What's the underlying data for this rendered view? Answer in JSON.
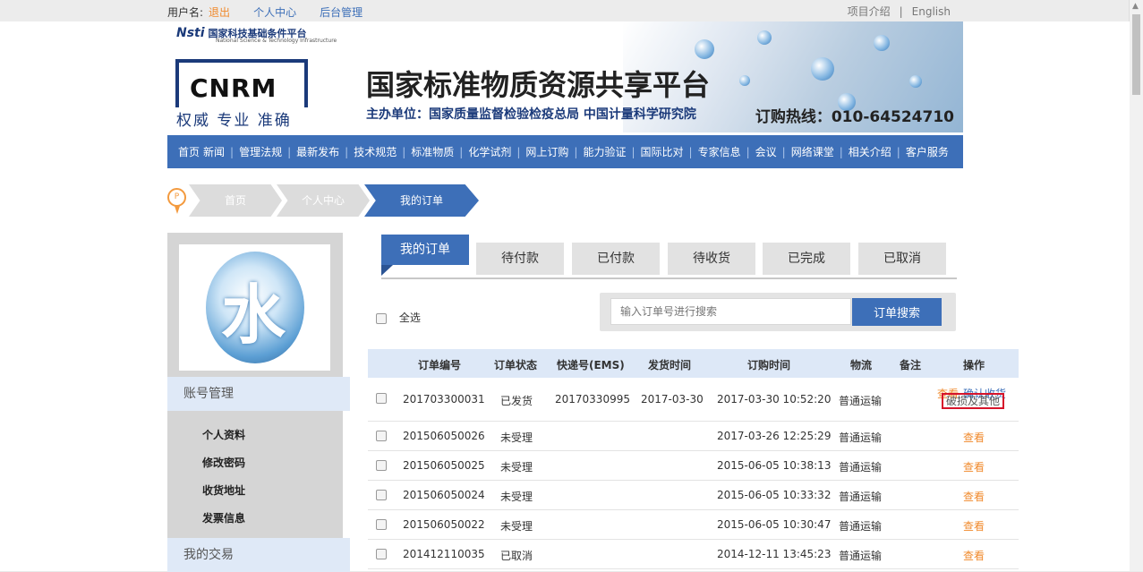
{
  "topbar": {
    "username_label": "用户名:",
    "logout": "退出",
    "personal_center": "个人中心",
    "admin": "后台管理",
    "project_intro": "项目介绍",
    "separator": "|",
    "english": "English"
  },
  "header": {
    "nsti_logo": "Nsti",
    "nsti_name": "国家科技基础条件平台",
    "nsti_sub": "National Science & Technology Infrastructure",
    "cnrm_logo": "CNRM",
    "slogan": "权威 专业 准确",
    "site_title": "国家标准物质资源共享平台",
    "organizer": "主办单位：国家质量监督检验检疫总局 中国计量科学研究院",
    "hotline": "订购热线：010-64524710"
  },
  "nav": {
    "items": [
      "首页",
      "新闻",
      "管理法规",
      "最新发布",
      "技术规范",
      "标准物质",
      "化学试剂",
      "网上订购",
      "能力验证",
      "国际比对",
      "专家信息",
      "会议",
      "网络课堂",
      "相关介绍",
      "客户服务"
    ]
  },
  "breadcrumb": {
    "pin": "P",
    "home": "首页",
    "personal_center": "个人中心",
    "my_orders": "我的订单"
  },
  "sidebar": {
    "avatar_char": "水",
    "account_title": "账号管理",
    "items": [
      "个人资料",
      "修改密码",
      "收货地址",
      "发票信息"
    ],
    "trade_title": "我的交易"
  },
  "tabs": [
    "我的订单",
    "待付款",
    "已付款",
    "待收货",
    "已完成",
    "已取消"
  ],
  "toolbar": {
    "select_all": "全选",
    "search_placeholder": "输入订单号进行搜索",
    "search_button": "订单搜索"
  },
  "table": {
    "headers": [
      "订单编号",
      "订单状态",
      "快递号(EMS)",
      "发货时间",
      "订购时间",
      "物流",
      "备注",
      "操作"
    ],
    "rows": [
      {
        "id": "201703300031",
        "status": "已发货",
        "ems": "20170330995",
        "ship": "2017-03-30",
        "order_time": "2017-03-30 10:52:20",
        "logistics": "普通运输",
        "view": "查看",
        "confirm": "确认收货",
        "damage": "破损及其他"
      },
      {
        "id": "201506050026",
        "status": "未受理",
        "ems": "",
        "ship": "",
        "order_time": "2017-03-26 12:25:29",
        "logistics": "普通运输",
        "view": "查看"
      },
      {
        "id": "201506050025",
        "status": "未受理",
        "ems": "",
        "ship": "",
        "order_time": "2015-06-05 10:38:13",
        "logistics": "普通运输",
        "view": "查看"
      },
      {
        "id": "201506050024",
        "status": "未受理",
        "ems": "",
        "ship": "",
        "order_time": "2015-06-05 10:33:32",
        "logistics": "普通运输",
        "view": "查看"
      },
      {
        "id": "201506050022",
        "status": "未受理",
        "ems": "",
        "ship": "",
        "order_time": "2015-06-05 10:30:47",
        "logistics": "普通运输",
        "view": "查看"
      },
      {
        "id": "201412110035",
        "status": "已取消",
        "ems": "",
        "ship": "",
        "order_time": "2014-12-11 13:45:23",
        "logistics": "普通运输",
        "view": "查看"
      }
    ]
  },
  "colors": {
    "brand_blue": "#3d6fb8",
    "link_orange": "#f08a2c",
    "highlight_red": "#d6142a"
  }
}
